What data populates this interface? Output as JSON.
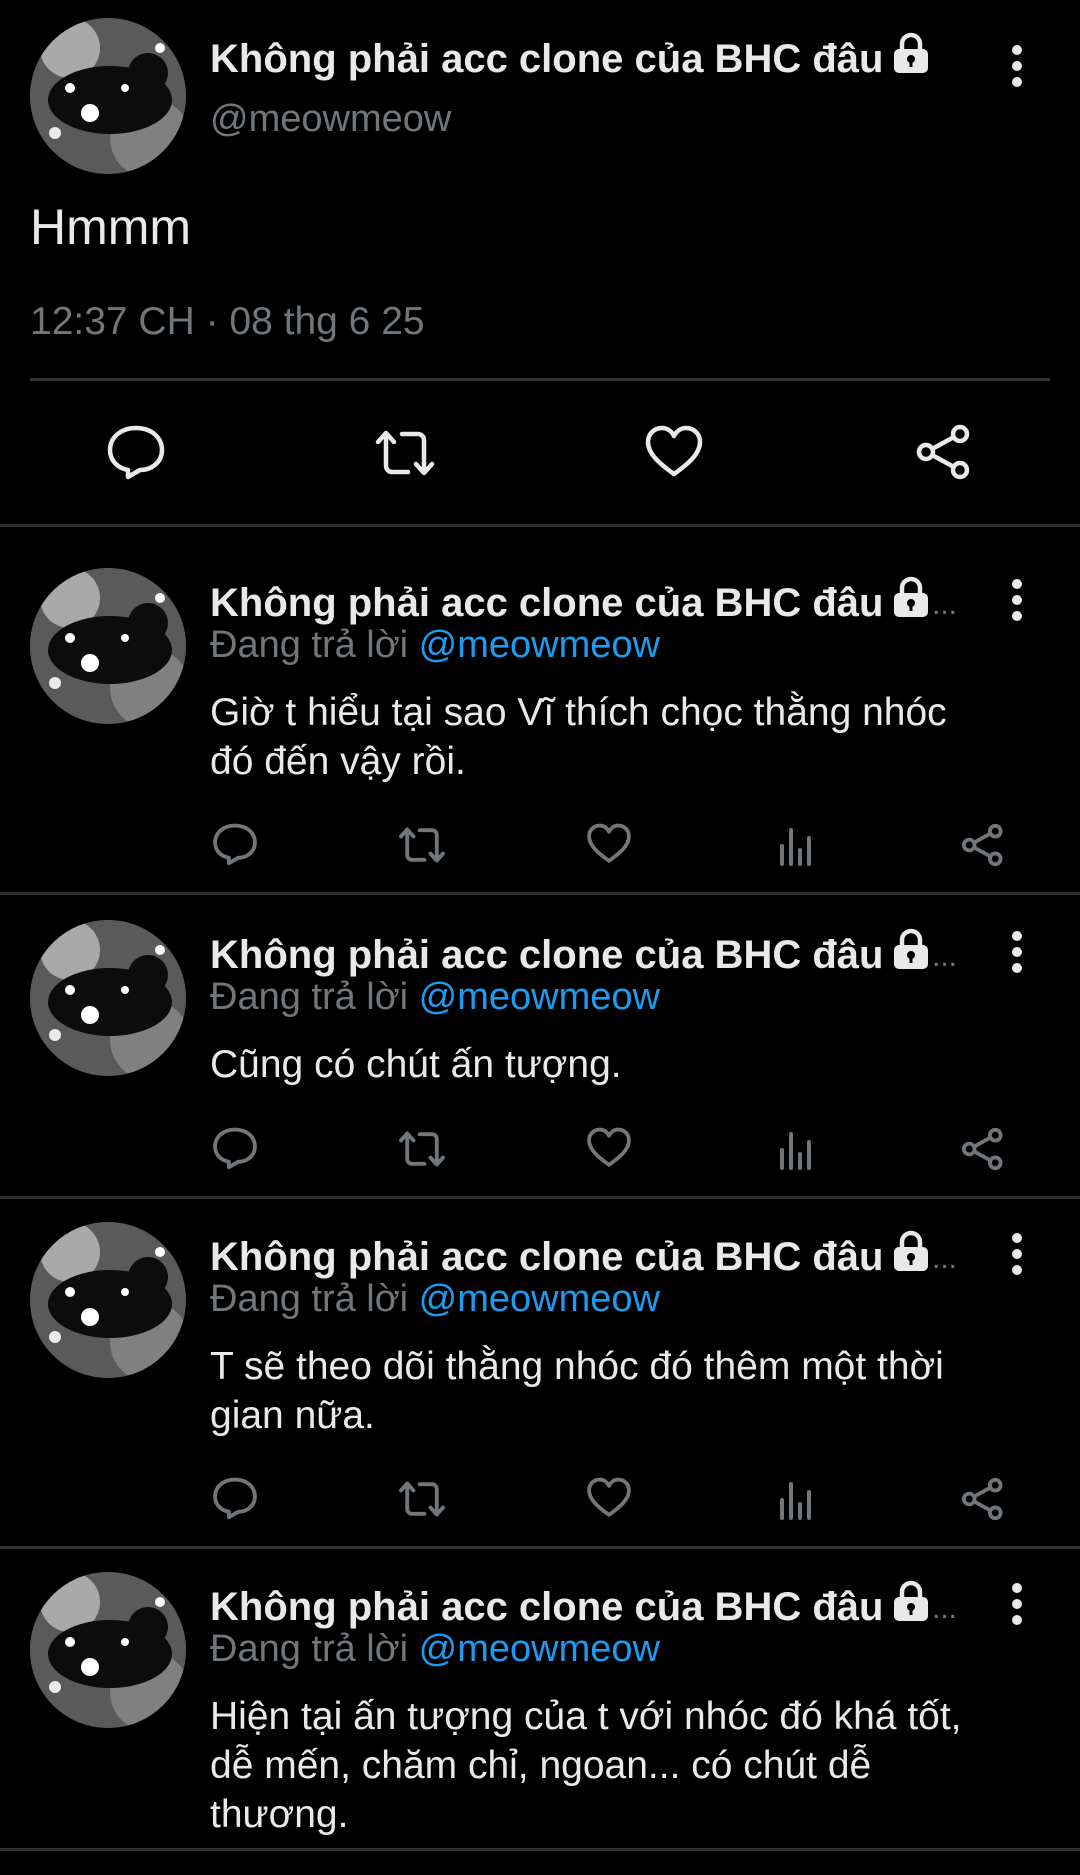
{
  "main_tweet": {
    "author_name": "Không phải acc clone của BHC đâu",
    "handle": "@meowmeow",
    "text": "Hmmm",
    "timestamp": "12:37 CH · 08 thg 6 25",
    "actions": [
      "reply-icon",
      "retweet-icon",
      "like-icon",
      "share-icon"
    ]
  },
  "replies": [
    {
      "author_name": "Không phải acc clone của BHC đâu",
      "reply_prefix": "Đang trả lời",
      "reply_to": "@meowmeow",
      "text_lines": [
        "Giờ t hiểu tại sao Vĩ thích chọc thằng nhóc",
        "đó đến vậy rồi."
      ]
    },
    {
      "author_name": "Không phải acc clone của BHC đâu",
      "reply_prefix": "Đang trả lời",
      "reply_to": "@meowmeow",
      "text_lines": [
        "Cũng có chút ấn tượng."
      ]
    },
    {
      "author_name": "Không phải acc clone của BHC đâu",
      "reply_prefix": "Đang trả lời",
      "reply_to": "@meowmeow",
      "text_lines": [
        "T sẽ theo dõi thằng nhóc đó thêm một thời",
        "gian nữa."
      ]
    },
    {
      "author_name": "Không phải acc clone của BHC đâu",
      "reply_prefix": "Đang trả lời",
      "reply_to": "@meowmeow",
      "text_lines": [
        "Hiện tại ấn tượng của t với nhóc đó khá tốt,",
        "dễ mến, chăm chỉ, ngoan... có chút dễ",
        "thương."
      ]
    }
  ],
  "truncation": "...",
  "colors": {
    "background": "#000000",
    "text": "#e7e9ea",
    "muted": "#71767b",
    "accent": "#1d9bf0"
  }
}
